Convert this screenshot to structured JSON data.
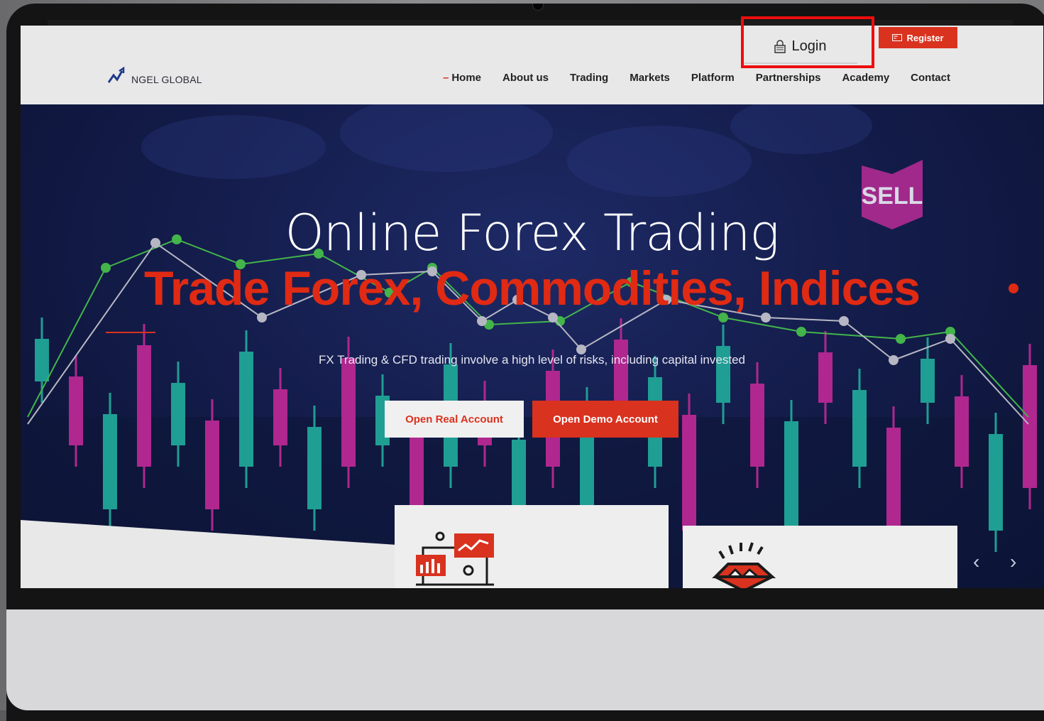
{
  "site": {
    "logo_text": "NGEL GLOBAL"
  },
  "header": {
    "login_label": "Login",
    "register_label": "Register",
    "nav": [
      "Home",
      "About us",
      "Trading",
      "Markets",
      "Platform",
      "Partnerships",
      "Academy",
      "Contact"
    ],
    "active_nav": "Home"
  },
  "hero": {
    "title": "Online Forex Trading",
    "subtitle": "Trade Forex, Commodities, Indices",
    "risk_warning": "FX Trading & CFD trading involve a high level of risks, including capital invested",
    "sell_badge": "SELL",
    "buttons": {
      "real": "Open Real Account",
      "demo": "Open Demo Account"
    }
  },
  "carousel": {
    "prev_icon": "chevron-left-icon",
    "next_icon": "chevron-right-icon"
  },
  "colors": {
    "accent": "#d9321f",
    "highlight": "#ee0d0d",
    "hero_bg": "#141d4c",
    "candle_teal": "#1f9e93",
    "candle_magenta": "#b0278f"
  },
  "icons": {
    "logo": "chart-arrow-logo-icon",
    "login": "lock-icon",
    "register": "card-icon",
    "card1": "analytics-dashboard-icon",
    "card2": "diamond-icon"
  }
}
